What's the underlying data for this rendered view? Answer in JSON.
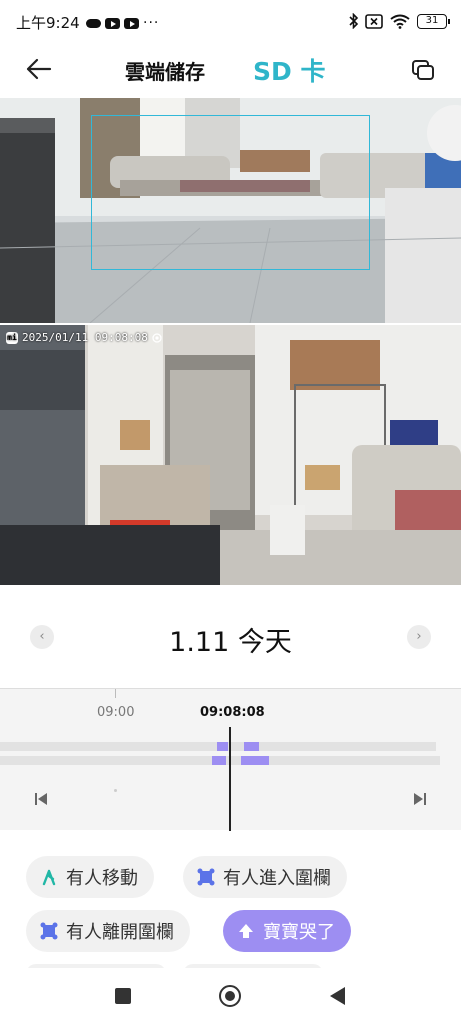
{
  "status_bar": {
    "time": "上午9:24",
    "more": "···",
    "battery": "31"
  },
  "header": {
    "back_icon": "arrow-left-icon",
    "tab_cloud": "雲端儲存",
    "tab_sd": "SD 卡",
    "multiview_icon": "multi-window-icon",
    "accent": "#2fb5c9"
  },
  "video": {
    "timestamp": "2025/01/11  09:08:08",
    "detect_box_color": "#31b8d8"
  },
  "date": {
    "label": "1.11 今天",
    "prev_icon": "chevron-left-icon",
    "next_icon": "chevron-right-icon"
  },
  "timeline": {
    "tick_label": "09:00",
    "current_time": "09:08:08",
    "event_color": "#9d8ef2"
  },
  "filters": [
    {
      "label": "有人移動",
      "icon": "person-walk-icon",
      "active": false
    },
    {
      "label": "有人進入圍欄",
      "icon": "fence-enter-icon",
      "active": false
    },
    {
      "label": "有人離開圍欄",
      "icon": "fence-exit-icon",
      "active": false
    },
    {
      "label": "寶寶哭了",
      "icon": "baby-cry-icon",
      "active": true
    }
  ]
}
